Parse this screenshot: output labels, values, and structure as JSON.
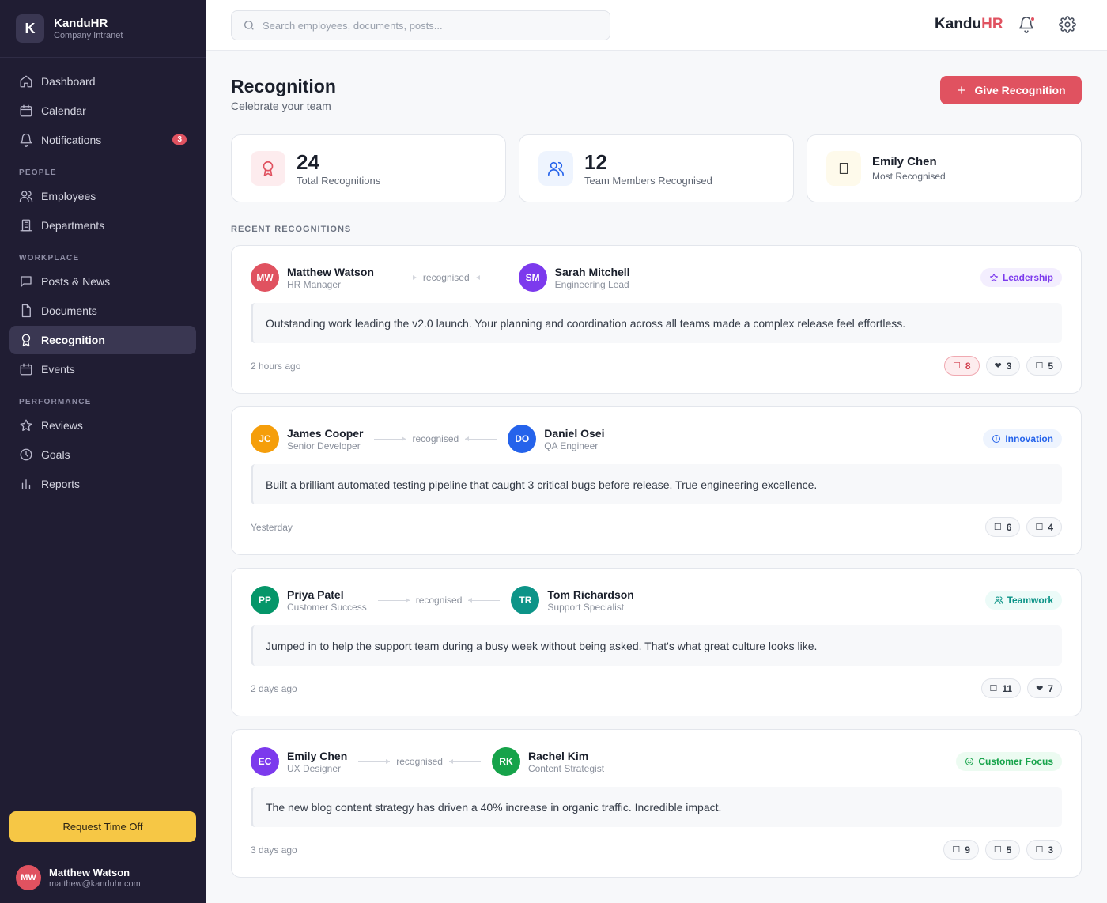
{
  "sidebar": {
    "brand_letter": "K",
    "brand_name": "KanduHR",
    "brand_sub": "Company Intranet",
    "nav_main": [
      {
        "label": "Dashboard",
        "icon": "home-icon"
      },
      {
        "label": "Calendar",
        "icon": "calendar-icon"
      },
      {
        "label": "Notifications",
        "icon": "bell-icon",
        "badge": "3"
      }
    ],
    "sections": {
      "people": "PEOPLE",
      "workplace": "WORKPLACE",
      "performance": "PERFORMANCE"
    },
    "nav_people": [
      {
        "label": "Employees",
        "icon": "users-icon"
      },
      {
        "label": "Departments",
        "icon": "building-icon"
      }
    ],
    "nav_workplace": [
      {
        "label": "Posts & News",
        "icon": "message-icon"
      },
      {
        "label": "Documents",
        "icon": "document-icon"
      },
      {
        "label": "Recognition",
        "icon": "award-icon",
        "active": true
      },
      {
        "label": "Events",
        "icon": "calendar-icon"
      }
    ],
    "nav_performance": [
      {
        "label": "Reviews",
        "icon": "star-icon"
      },
      {
        "label": "Goals",
        "icon": "clock-icon"
      },
      {
        "label": "Reports",
        "icon": "bar-chart-icon"
      }
    ],
    "request_button": "Request Time Off",
    "user": {
      "initials": "MW",
      "name": "Matthew Watson",
      "email": "matthew@kanduhr.com"
    }
  },
  "topbar": {
    "search_placeholder": "Search employees, documents, posts...",
    "brand_a": "Kandu",
    "brand_b": "HR"
  },
  "page": {
    "title": "Recognition",
    "subtitle": "Celebrate your team",
    "give_button": "Give Recognition",
    "section_label": "RECENT RECOGNITIONS"
  },
  "stats": {
    "total": {
      "value": "24",
      "label": "Total Recognitions"
    },
    "members": {
      "value": "12",
      "label": "Team Members Recognised"
    },
    "top": {
      "name": "Emily Chen",
      "label": "Most Recognised"
    }
  },
  "connector_text": "recognised",
  "recognitions": [
    {
      "from": {
        "initials": "MW",
        "name": "Matthew Watson",
        "role": "HR Manager",
        "color": "#e05260"
      },
      "to": {
        "initials": "SM",
        "name": "Sarah Mitchell",
        "role": "Engineering Lead",
        "color": "#7c3aed"
      },
      "tag": {
        "label": "Leadership",
        "color": "#7c3aed",
        "bg": "#f3eefe",
        "icon": "star-icon"
      },
      "message": "Outstanding work leading the v2.0 launch. Your planning and coordination across all teams made a complex release feel effortless.",
      "time": "2 hours ago",
      "reactions": [
        {
          "emoji": "☐",
          "count": "8",
          "active": true
        },
        {
          "emoji": "❤",
          "count": "3"
        },
        {
          "emoji": "☐",
          "count": "5"
        }
      ]
    },
    {
      "from": {
        "initials": "JC",
        "name": "James Cooper",
        "role": "Senior Developer",
        "color": "#f59e0b"
      },
      "to": {
        "initials": "DO",
        "name": "Daniel Osei",
        "role": "QA Engineer",
        "color": "#2563eb"
      },
      "tag": {
        "label": "Innovation",
        "color": "#2563eb",
        "bg": "#eef4fe",
        "icon": "lightbulb-icon"
      },
      "message": "Built a brilliant automated testing pipeline that caught 3 critical bugs before release. True engineering excellence.",
      "time": "Yesterday",
      "reactions": [
        {
          "emoji": "☐",
          "count": "6"
        },
        {
          "emoji": "☐",
          "count": "4"
        }
      ]
    },
    {
      "from": {
        "initials": "PP",
        "name": "Priya Patel",
        "role": "Customer Success",
        "color": "#059669"
      },
      "to": {
        "initials": "TR",
        "name": "Tom Richardson",
        "role": "Support Specialist",
        "color": "#0d9488"
      },
      "tag": {
        "label": "Teamwork",
        "color": "#0d9488",
        "bg": "#ecfbf8",
        "icon": "users-icon"
      },
      "message": "Jumped in to help the support team during a busy week without being asked. That's what great culture looks like.",
      "time": "2 days ago",
      "reactions": [
        {
          "emoji": "☐",
          "count": "11"
        },
        {
          "emoji": "❤",
          "count": "7"
        }
      ]
    },
    {
      "from": {
        "initials": "EC",
        "name": "Emily Chen",
        "role": "UX Designer",
        "color": "#7c3aed"
      },
      "to": {
        "initials": "RK",
        "name": "Rachel Kim",
        "role": "Content Strategist",
        "color": "#16a34a"
      },
      "tag": {
        "label": "Customer Focus",
        "color": "#16a34a",
        "bg": "#ecfbf1",
        "icon": "smile-icon"
      },
      "message": "The new blog content strategy has driven a 40% increase in organic traffic. Incredible impact.",
      "time": "3 days ago",
      "reactions": [
        {
          "emoji": "☐",
          "count": "9"
        },
        {
          "emoji": "☐",
          "count": "5"
        },
        {
          "emoji": "☐",
          "count": "3"
        }
      ]
    }
  ]
}
